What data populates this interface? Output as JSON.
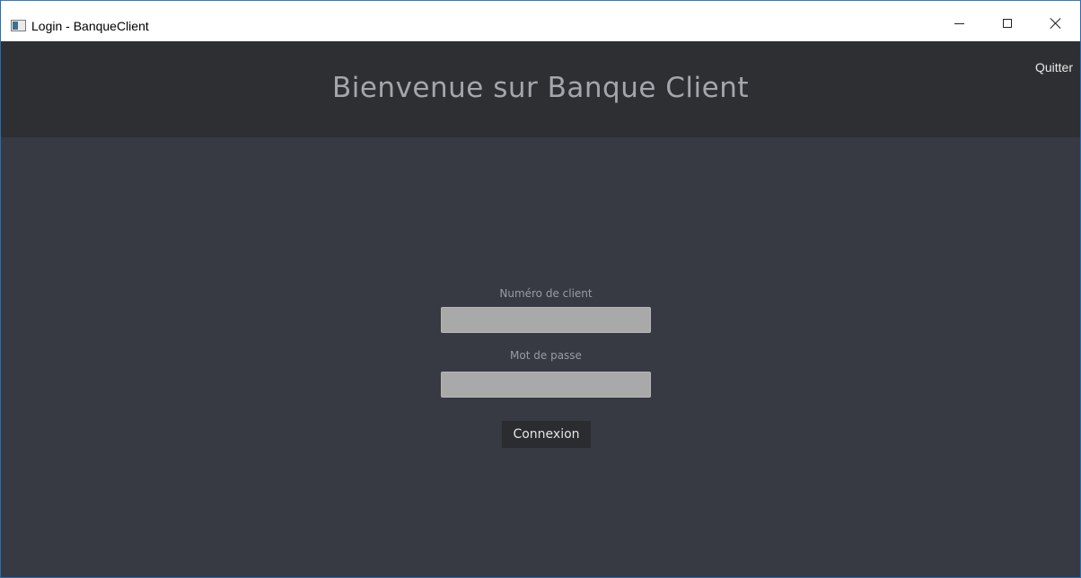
{
  "window": {
    "title": "Login - BanqueClient",
    "icon": "app-window-icon"
  },
  "window_controls": {
    "minimize_icon": "minimize-icon",
    "maximize_icon": "maximize-icon",
    "close_icon": "close-icon"
  },
  "header": {
    "title": "Bienvenue sur Banque Client",
    "quit_label": "Quitter"
  },
  "login_form": {
    "client_number_label": "Numéro de client",
    "client_number_value": "",
    "password_label": "Mot de passe",
    "password_value": "",
    "submit_label": "Connexion"
  },
  "colors": {
    "header_background": "#2e2f33",
    "main_background": "#373943",
    "input_background": "#a9a9aa",
    "button_background": "#2b2c30",
    "title_text": "#a3a6ab"
  }
}
